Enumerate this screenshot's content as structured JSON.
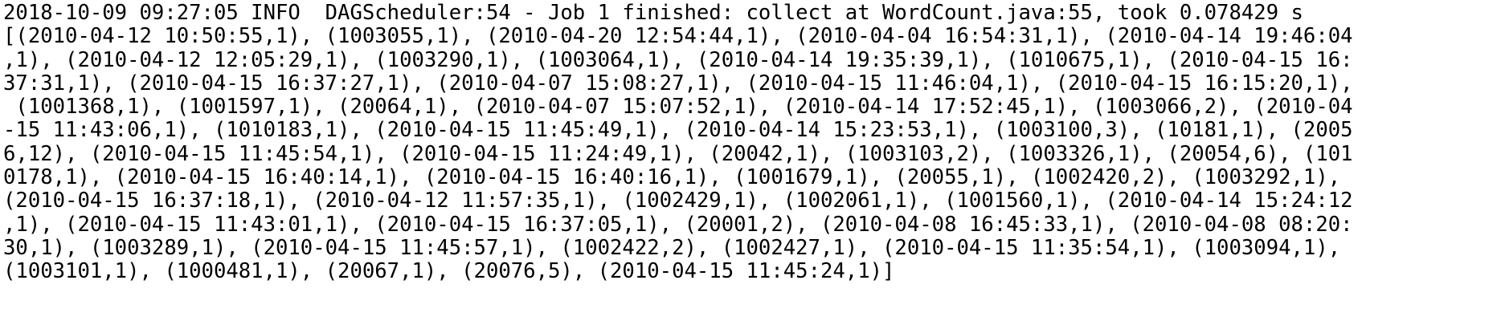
{
  "terminal": {
    "lines": [
      "2018-10-09 09:27:05 INFO  DAGScheduler:54 - Job 1 finished: collect at WordCount.java:55, took 0.078429 s",
      "[(2010-04-12 10:50:55,1), (1003055,1), (2010-04-20 12:54:44,1), (2010-04-04 16:54:31,1), (2010-04-14 19:46:04",
      ",1), (2010-04-12 12:05:29,1), (1003290,1), (1003064,1), (2010-04-14 19:35:39,1), (1010675,1), (2010-04-15 16:",
      "37:31,1), (2010-04-15 16:37:27,1), (2010-04-07 15:08:27,1), (2010-04-15 11:46:04,1), (2010-04-15 16:15:20,1),",
      " (1001368,1), (1001597,1), (20064,1), (2010-04-07 15:07:52,1), (2010-04-14 17:52:45,1), (1003066,2), (2010-04",
      "-15 11:43:06,1), (1010183,1), (2010-04-15 11:45:49,1), (2010-04-14 15:23:53,1), (1003100,3), (10181,1), (2005",
      "6,12), (2010-04-15 11:45:54,1), (2010-04-15 11:24:49,1), (20042,1), (1003103,2), (1003326,1), (20054,6), (101",
      "0178,1), (2010-04-15 16:40:14,1), (2010-04-15 16:40:16,1), (1001679,1), (20055,1), (1002420,2), (1003292,1),",
      "(2010-04-15 16:37:18,1), (2010-04-12 11:57:35,1), (1002429,1), (1002061,1), (1001560,1), (2010-04-14 15:24:12",
      ",1), (2010-04-15 11:43:01,1), (2010-04-15 16:37:05,1), (20001,2), (2010-04-08 16:45:33,1), (2010-04-08 08:20:",
      "30,1), (1003289,1), (2010-04-15 11:45:57,1), (1002422,2), (1002427,1), (2010-04-15 11:35:54,1), (1003094,1),",
      "(1003101,1), (1000481,1), (20067,1), (20076,5), (2010-04-15 11:45:24,1)]"
    ]
  }
}
